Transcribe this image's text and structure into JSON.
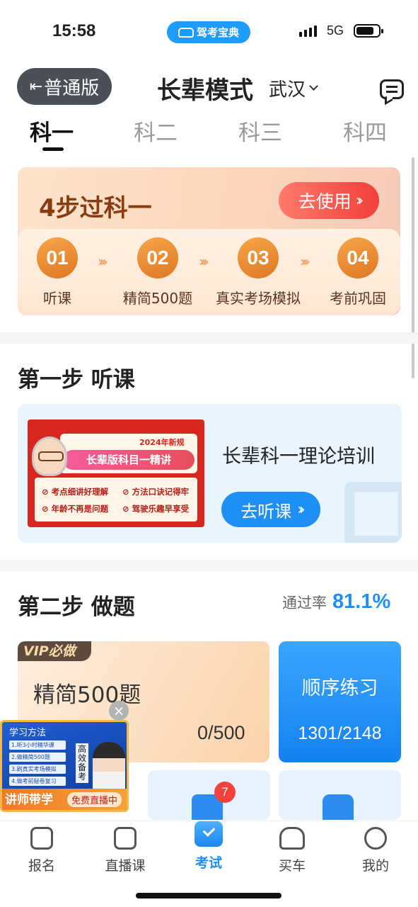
{
  "status_bar": {
    "time": "15:58",
    "app_pill": "驾考宝典",
    "network": "5G"
  },
  "header": {
    "switch_label": "普通版",
    "title": "长辈模式",
    "city": "武汉"
  },
  "tabs": [
    {
      "label": "科一",
      "active": true
    },
    {
      "label": "科二",
      "active": false
    },
    {
      "label": "科三",
      "active": false
    },
    {
      "label": "科四",
      "active": false
    }
  ],
  "steps_card": {
    "headline": "4步过科一",
    "use_button": "去使用",
    "steps": [
      {
        "num": "01",
        "label": "听课"
      },
      {
        "num": "02",
        "label": "精简500题"
      },
      {
        "num": "03",
        "label": "真实考场模拟"
      },
      {
        "num": "04",
        "label": "考前巩固"
      }
    ]
  },
  "section_listen": {
    "title": "第一步 听课",
    "thumb": {
      "year_tag": "2024年新规",
      "title": "长辈版科目一精讲",
      "features": [
        "考点细讲好理解",
        "方法口诀记得牢",
        "年龄不再是问题",
        "驾驶乐趣早享受"
      ]
    },
    "course_name": "长辈科一理论培训",
    "listen_button": "去听课"
  },
  "section_practice": {
    "title": "第二步 做题",
    "pass_rate_label": "通过率",
    "pass_rate_value": "81.1%",
    "card_500": {
      "badge": "VIP必做",
      "title": "精简500题",
      "progress": "0/500"
    },
    "card_seq": {
      "title": "顺序练习",
      "progress": "1301/2148"
    },
    "tile_badge": "7"
  },
  "float_ad": {
    "header": "学习方法",
    "board": [
      "1.听3小时精华课",
      "2.做精简500题",
      "3.刷真实考场模拟",
      "4.做考前秘卷复习"
    ],
    "side_text": "高效备考",
    "bar_left": "讲师带学",
    "bar_right": "免费直播中",
    "close": "×"
  },
  "bottom_nav": [
    {
      "label": "报名",
      "icon": "signup-icon",
      "active": false
    },
    {
      "label": "直播课",
      "icon": "live-tv-icon",
      "active": false
    },
    {
      "label": "考试",
      "icon": "exam-check-icon",
      "active": true
    },
    {
      "label": "买车",
      "icon": "car-icon",
      "active": false
    },
    {
      "label": "我的",
      "icon": "profile-smile-icon",
      "active": false
    }
  ],
  "colors": {
    "accent_blue": "#1e8ff5",
    "steps_orange": "#df7722",
    "headline_brown": "#8a3c11",
    "use_button_red": "#f1403a"
  }
}
